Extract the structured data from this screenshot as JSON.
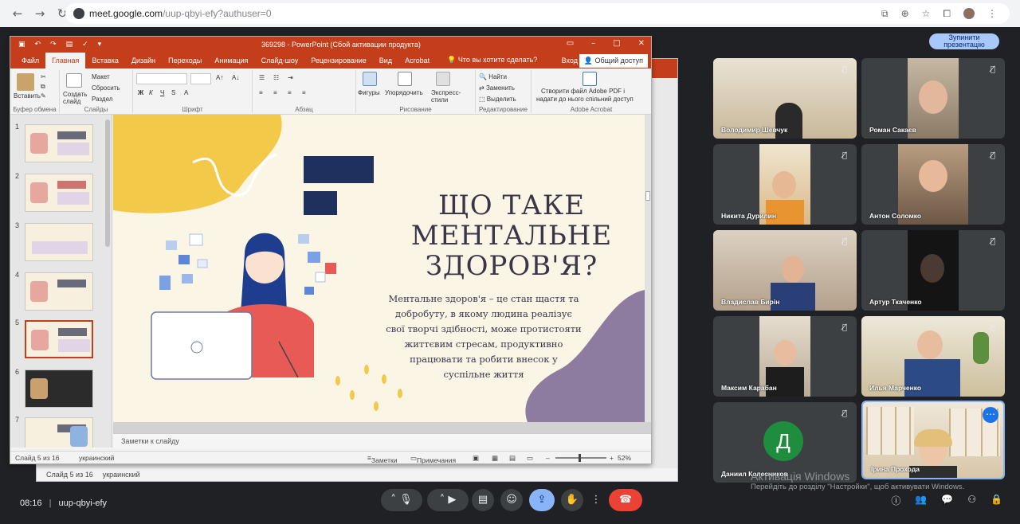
{
  "browser": {
    "url_host": "meet.google.com",
    "url_path": "/uup-qbyi-efy?authuser=0"
  },
  "meet": {
    "stop_presenting_label": "Зупинити презентацію",
    "time": "08:16",
    "meeting_code": "uup-qbyi-efy",
    "participants": [
      {
        "name": "Володимир Шевчук",
        "muted": true
      },
      {
        "name": "Роман Сакаєв",
        "muted": true
      },
      {
        "name": "Никита Дурилин",
        "muted": true
      },
      {
        "name": "Антон Соломко",
        "muted": true
      },
      {
        "name": "Владислав Бирін",
        "muted": true
      },
      {
        "name": "Артур Ткаченко",
        "muted": true
      },
      {
        "name": "Максим Карабан",
        "muted": true
      },
      {
        "name": "Илья Марченко",
        "muted": true
      },
      {
        "name": "Даниил Колесников",
        "muted": true,
        "avatar_letter": "Д"
      },
      {
        "name": "Ірина Прохода",
        "muted": false
      }
    ],
    "watermark_title": "Активація Windows",
    "watermark_text": "Перейдіть до розділу \"Настройки\", щоб активувати Windows."
  },
  "ppt": {
    "window_title": "369298 - PowerPoint (Сбой активации продукта)",
    "tabs": [
      "Файл",
      "Главная",
      "Вставка",
      "Дизайн",
      "Переходы",
      "Анимация",
      "Слайд-шоу",
      "Рецензирование",
      "Вид",
      "Acrobat"
    ],
    "active_tab": "Главная",
    "tell_me": "Что вы хотите сделать?",
    "login": "Вход",
    "share": "Общий доступ",
    "ribbon": {
      "paste": "Вставить",
      "clipboard_group": "Буфер обмена",
      "new_slide": "Создать слайд",
      "layout": "Макет",
      "reset": "Сбросить",
      "section": "Раздел",
      "slides_group": "Слайды",
      "font_group": "Шрифт",
      "paragraph_group": "Абзац",
      "shapes": "Фигуры",
      "arrange": "Упорядочить",
      "quick_styles": "Экспресс-стили",
      "drawing_group": "Рисование",
      "find": "Найти",
      "replace": "Заменить",
      "select": "Выделить",
      "editing_group": "Редактирование",
      "acrobat_btn_line1": "Створити файл Adobe PDF і",
      "acrobat_btn_line2": "надати до нього спільний доступ",
      "acrobat_group": "Adobe Acrobat"
    },
    "thumbnail_numbers": [
      "1",
      "2",
      "3",
      "4",
      "5",
      "6",
      "7"
    ],
    "selected_slide": 5,
    "slide": {
      "title_lines": [
        "ЩО ТАКЕ",
        "МЕНТАЛЬНЕ",
        "ЗДОРОВ'Я?"
      ],
      "body_lines": [
        "Ментальне здоров'я – це стан щастя та",
        "добробуту, в якому людина реалізує",
        "свої творчі здібності, може протистояти",
        "життєвим стресам, продуктивно",
        "працювати та робити внесок у",
        "суспільне життя"
      ]
    },
    "notes_placeholder": "Заметки к слайду",
    "status": {
      "slide_of": "Слайд 5 из 16",
      "language": "украинский",
      "notes": "Заметки",
      "comments": "Примечания",
      "zoom": "52%"
    }
  },
  "colors": {
    "ppt_red": "#c43e1c",
    "meet_bg": "#202124",
    "end_call": "#ea4335",
    "present_blue": "#8ab4f8"
  }
}
